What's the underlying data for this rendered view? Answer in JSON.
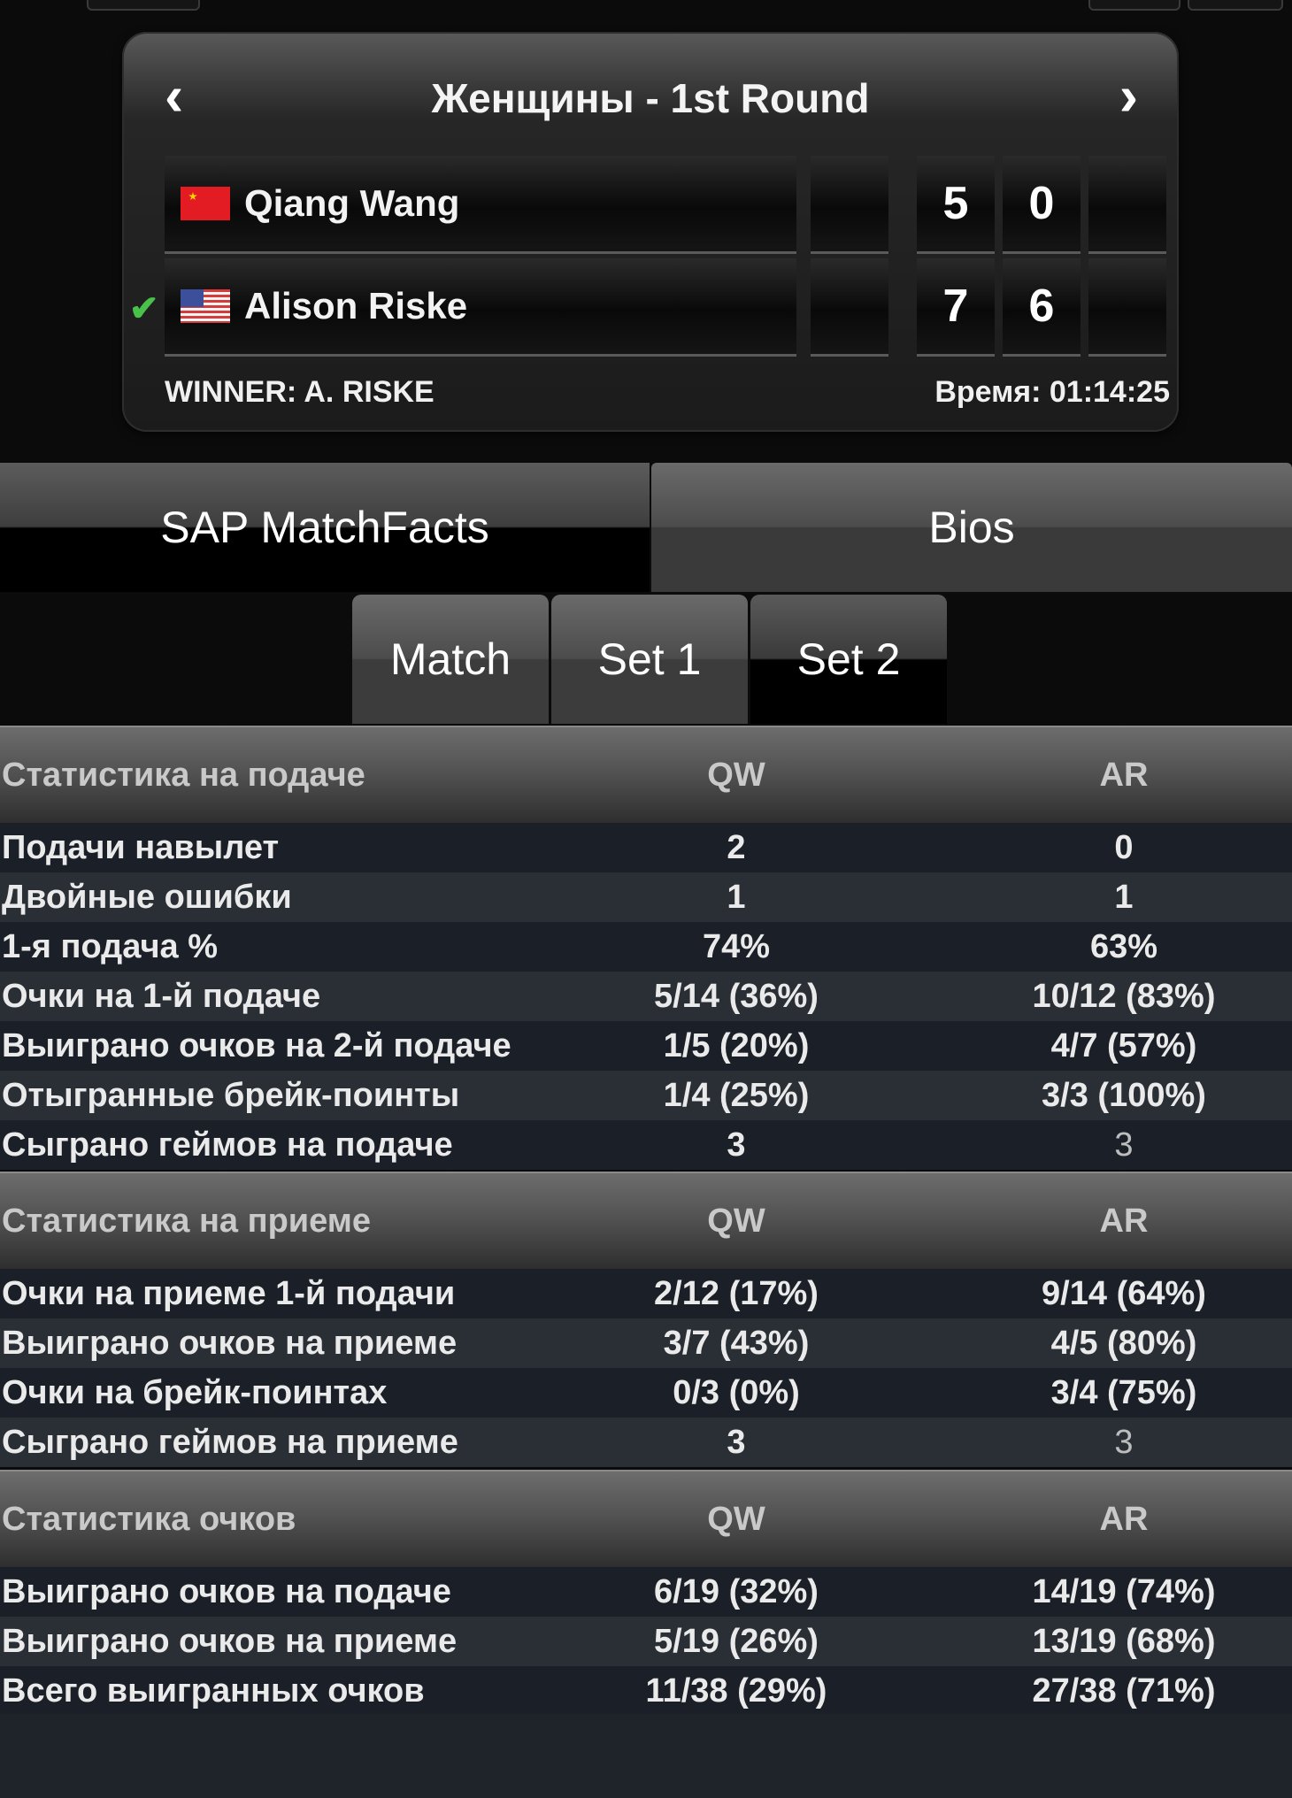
{
  "header": {
    "title": "Женщины - 1st Round",
    "prev_arrow": "‹",
    "next_arrow": "›"
  },
  "players": [
    {
      "name": "Qiang Wang",
      "flag": "china-flag",
      "sets": [
        "5",
        "0"
      ],
      "winner": false
    },
    {
      "name": "Alison Riske",
      "flag": "usa-flag",
      "sets": [
        "7",
        "6"
      ],
      "winner": true
    }
  ],
  "winner_text": "WINNER: A. RISKE",
  "time_text": "Время: 01:14:25",
  "tabs": {
    "main": [
      "SAP MatchFacts",
      "Bios"
    ],
    "sub": [
      "Match",
      "Set 1",
      "Set 2"
    ]
  },
  "stats": [
    {
      "title": "Статистика на подаче",
      "col_qw": "QW",
      "col_ar": "AR",
      "rows": [
        {
          "label": "Подачи навылет",
          "qw": "2",
          "ar": "0"
        },
        {
          "label": "Двойные ошибки",
          "qw": "1",
          "ar": "1"
        },
        {
          "label": "1-я подача %",
          "qw": "74%",
          "ar": "63%"
        },
        {
          "label": "Очки на 1-й подаче",
          "qw": "5/14 (36%)",
          "ar": "10/12 (83%)"
        },
        {
          "label": "Выиграно очков на 2-й подаче",
          "qw": "1/5 (20%)",
          "ar": "4/7 (57%)"
        },
        {
          "label": "Отыгранные брейк-поинты",
          "qw": "1/4 (25%)",
          "ar": "3/3 (100%)"
        },
        {
          "label": "Сыграно геймов на подаче",
          "qw": "3",
          "ar": "3"
        }
      ]
    },
    {
      "title": "Статистика на приеме",
      "col_qw": "QW",
      "col_ar": "AR",
      "rows": [
        {
          "label": "Очки на приеме 1-й подачи",
          "qw": "2/12 (17%)",
          "ar": "9/14 (64%)"
        },
        {
          "label": "Выиграно очков на приеме",
          "qw": "3/7 (43%)",
          "ar": "4/5 (80%)"
        },
        {
          "label": "Очки на брейк-поинтах",
          "qw": "0/3 (0%)",
          "ar": "3/4 (75%)"
        },
        {
          "label": "Сыграно геймов на приеме",
          "qw": "3",
          "ar": "3"
        }
      ]
    },
    {
      "title": "Статистика очков",
      "col_qw": "QW",
      "col_ar": "AR",
      "rows": [
        {
          "label": "Выиграно очков на подаче",
          "qw": "6/19 (32%)",
          "ar": "14/19 (74%)"
        },
        {
          "label": "Выиграно очков на приеме",
          "qw": "5/19 (26%)",
          "ar": "13/19 (68%)"
        },
        {
          "label": "Всего выигранных очков",
          "qw": "11/38 (29%)",
          "ar": "27/38 (71%)"
        }
      ]
    }
  ]
}
